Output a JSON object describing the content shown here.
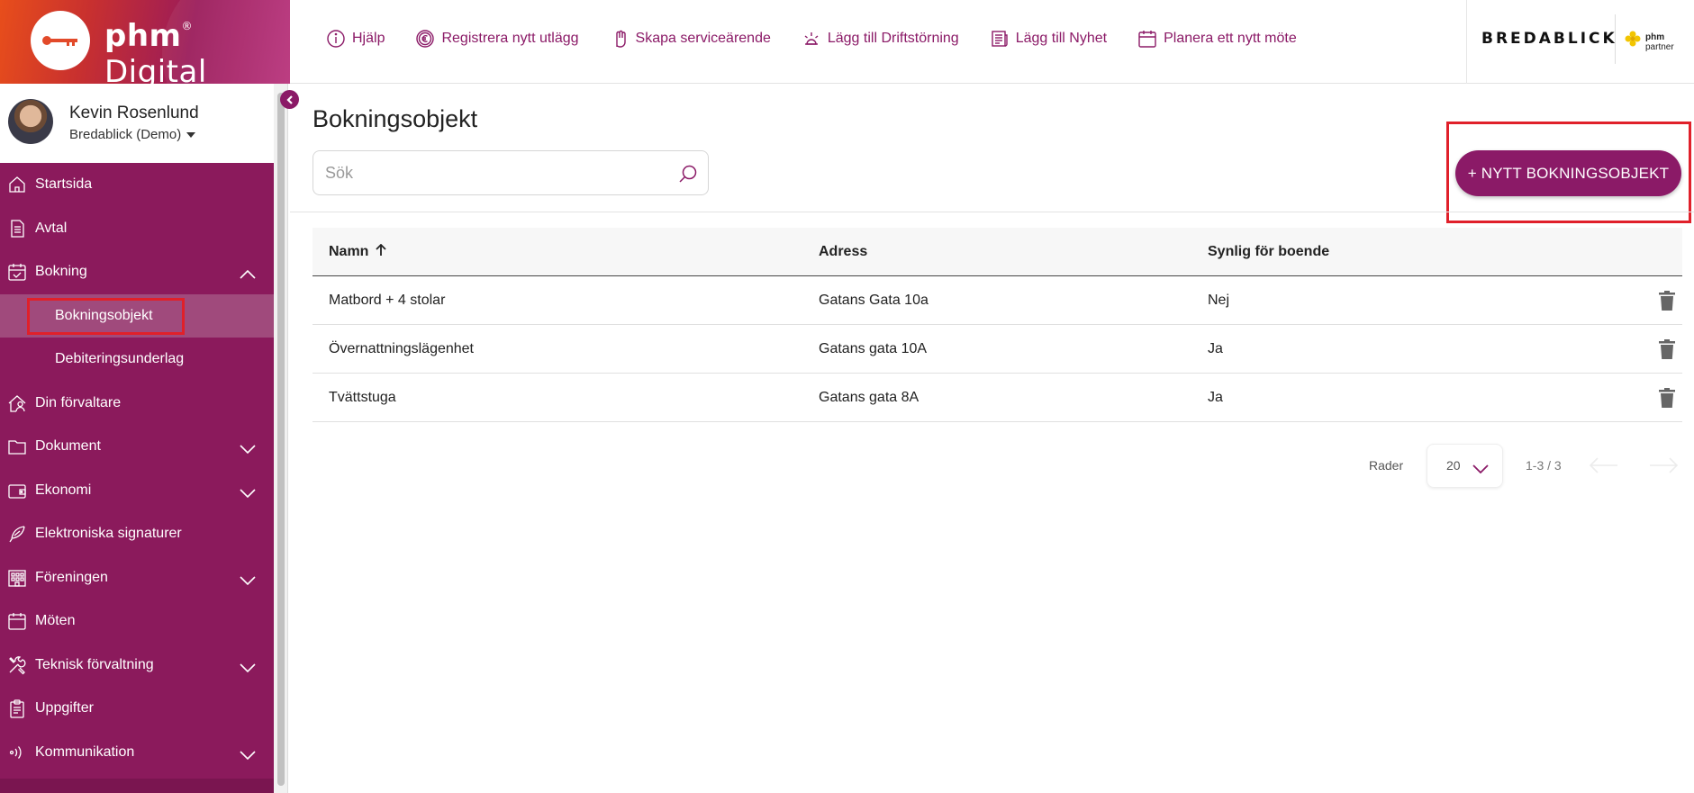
{
  "brand": {
    "name_bold": "phm",
    "name_light": "Digital",
    "registered": "®"
  },
  "topnav": [
    {
      "label": "Hjälp",
      "icon": "info-icon"
    },
    {
      "label": "Registrera nytt utlägg",
      "icon": "euro-icon"
    },
    {
      "label": "Skapa serviceärende",
      "icon": "hand-icon"
    },
    {
      "label": "Lägg till Driftstörning",
      "icon": "alert-light-icon"
    },
    {
      "label": "Lägg till Nyhet",
      "icon": "news-icon"
    },
    {
      "label": "Planera ett nytt möte",
      "icon": "calendar-icon"
    }
  ],
  "partner": {
    "name": "BREDABLICK",
    "tag_bold": "phm",
    "tag_rest": "partner"
  },
  "profile": {
    "name": "Kevin Rosenlund",
    "org": "Bredablick (Demo)"
  },
  "sidebar": {
    "items": [
      {
        "label": "Startsida",
        "icon": "home-icon",
        "expandable": false
      },
      {
        "label": "Avtal",
        "icon": "document-icon",
        "expandable": false
      },
      {
        "label": "Bokning",
        "icon": "calendar-check-icon",
        "expandable": true,
        "expanded": true,
        "children": [
          {
            "label": "Bokningsobjekt",
            "active": true
          },
          {
            "label": "Debiteringsunderlag",
            "active": false
          }
        ]
      },
      {
        "label": "Din förvaltare",
        "icon": "person-house-icon",
        "expandable": false
      },
      {
        "label": "Dokument",
        "icon": "folder-icon",
        "expandable": true
      },
      {
        "label": "Ekonomi",
        "icon": "wallet-icon",
        "expandable": true
      },
      {
        "label": "Elektroniska signaturer",
        "icon": "feather-icon",
        "expandable": false
      },
      {
        "label": "Föreningen",
        "icon": "building-icon",
        "expandable": true
      },
      {
        "label": "Möten",
        "icon": "calendar-icon",
        "expandable": false
      },
      {
        "label": "Teknisk förvaltning",
        "icon": "tools-icon",
        "expandable": true
      },
      {
        "label": "Uppgifter",
        "icon": "clipboard-icon",
        "expandable": false
      },
      {
        "label": "Kommunikation",
        "icon": "broadcast-icon",
        "expandable": true
      }
    ]
  },
  "main": {
    "title": "Bokningsobjekt",
    "search_placeholder": "Sök",
    "new_button": "+ NYTT BOKNINGSOBJEKT",
    "table": {
      "columns": [
        "Namn",
        "Adress",
        "Synlig för boende"
      ],
      "sort_column": "Namn",
      "sort_direction": "ascending",
      "rows": [
        {
          "name": "Matbord + 4 stolar",
          "address": "Gatans Gata 10a",
          "visible": "Nej"
        },
        {
          "name": "Övernattningslägenhet",
          "address": "Gatans gata 10A",
          "visible": "Ja"
        },
        {
          "name": "Tvättstuga",
          "address": "Gatans gata 8A",
          "visible": "Ja"
        }
      ]
    },
    "pagination": {
      "rows_label": "Rader",
      "rows_per_page": "20",
      "range": "1-3 / 3"
    }
  },
  "colors": {
    "accent": "#8b1a67",
    "sidebar_bg": "#8b1a5c",
    "highlight": "#e0202a"
  }
}
